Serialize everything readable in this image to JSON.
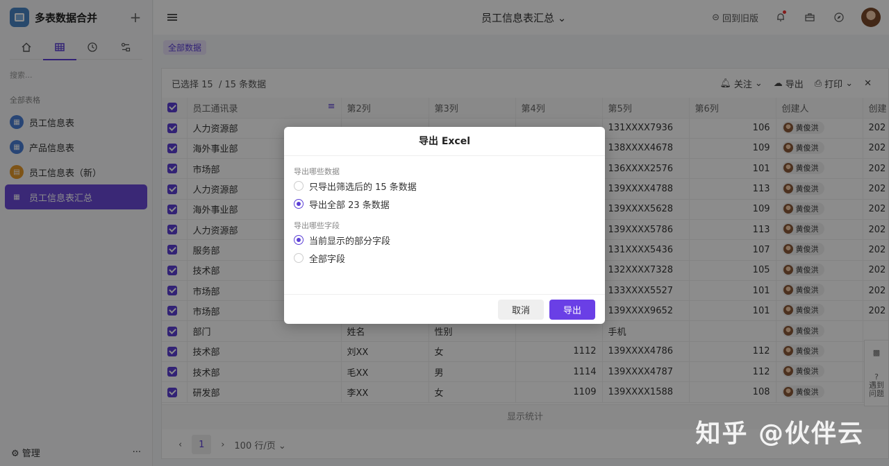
{
  "sidebar": {
    "app_title": "多表数据合并",
    "search_placeholder": "搜索...",
    "section_label": "全部表格",
    "items": [
      {
        "label": "员工信息表"
      },
      {
        "label": "产品信息表"
      },
      {
        "label": "员工信息表（新）"
      },
      {
        "label": "员工信息表汇总"
      }
    ],
    "footer_label": "管理",
    "footer_more": "···"
  },
  "topbar": {
    "title": "员工信息表汇总",
    "back_old": "回到旧版"
  },
  "view": {
    "tab": "全部数据"
  },
  "table_head": {
    "selected": "已选择 15",
    "total": "/ 15 条数据",
    "follow": "关注",
    "export": "导出",
    "print": "打印"
  },
  "table": {
    "columns": [
      "员工通讯录",
      "第2列",
      "第3列",
      "第4列",
      "第5列",
      "第6列",
      "创建人",
      "创建"
    ],
    "rows": [
      [
        "人力资源部",
        "",
        "",
        "",
        "131XXXX7936",
        "106",
        "黄俊洪",
        "202"
      ],
      [
        "海外事业部",
        "",
        "",
        "",
        "138XXXX4678",
        "109",
        "黄俊洪",
        "202"
      ],
      [
        "市场部",
        "",
        "",
        "",
        "136XXXX2576",
        "101",
        "黄俊洪",
        "202"
      ],
      [
        "人力资源部",
        "",
        "",
        "",
        "139XXXX4788",
        "113",
        "黄俊洪",
        "202"
      ],
      [
        "海外事业部",
        "",
        "",
        "",
        "139XXXX5628",
        "109",
        "黄俊洪",
        "202"
      ],
      [
        "人力资源部",
        "",
        "",
        "",
        "139XXXX5786",
        "113",
        "黄俊洪",
        "202"
      ],
      [
        "服务部",
        "",
        "",
        "",
        "131XXXX5436",
        "107",
        "黄俊洪",
        "202"
      ],
      [
        "技术部",
        "",
        "",
        "",
        "132XXXX7328",
        "105",
        "黄俊洪",
        "202"
      ],
      [
        "市场部",
        "",
        "",
        "",
        "133XXXX5527",
        "101",
        "黄俊洪",
        "202"
      ],
      [
        "市场部",
        "",
        "",
        "",
        "139XXXX9652",
        "101",
        "黄俊洪",
        "202"
      ],
      [
        "部门",
        "姓名",
        "性别",
        "",
        "手机",
        "",
        "黄俊洪",
        ""
      ],
      [
        "技术部",
        "刘XX",
        "女",
        "1112",
        "139XXXX4786",
        "112",
        "黄俊洪",
        "202"
      ],
      [
        "技术部",
        "毛XX",
        "男",
        "1114",
        "139XXXX4787",
        "112",
        "黄俊洪",
        "202"
      ],
      [
        "研发部",
        "李XX",
        "女",
        "1109",
        "139XXXX1588",
        "108",
        "黄俊洪",
        "202"
      ]
    ]
  },
  "footer": {
    "stats": "显示统计",
    "page": "1",
    "per_page": "100 行/页"
  },
  "side_tools": {
    "help": "遇到问题"
  },
  "modal": {
    "title": "导出 Excel",
    "group1_label": "导出哪些数据",
    "opt1": "只导出筛选后的 15 条数据",
    "opt2": "导出全部 23 条数据",
    "group2_label": "导出哪些字段",
    "opt3": "当前显示的部分字段",
    "opt4": "全部字段",
    "cancel": "取消",
    "confirm": "导出"
  },
  "watermark": "知乎 @伙伴云",
  "colors": {
    "accent": "#5b3fd6",
    "primary_button": "#6a3fe6"
  }
}
